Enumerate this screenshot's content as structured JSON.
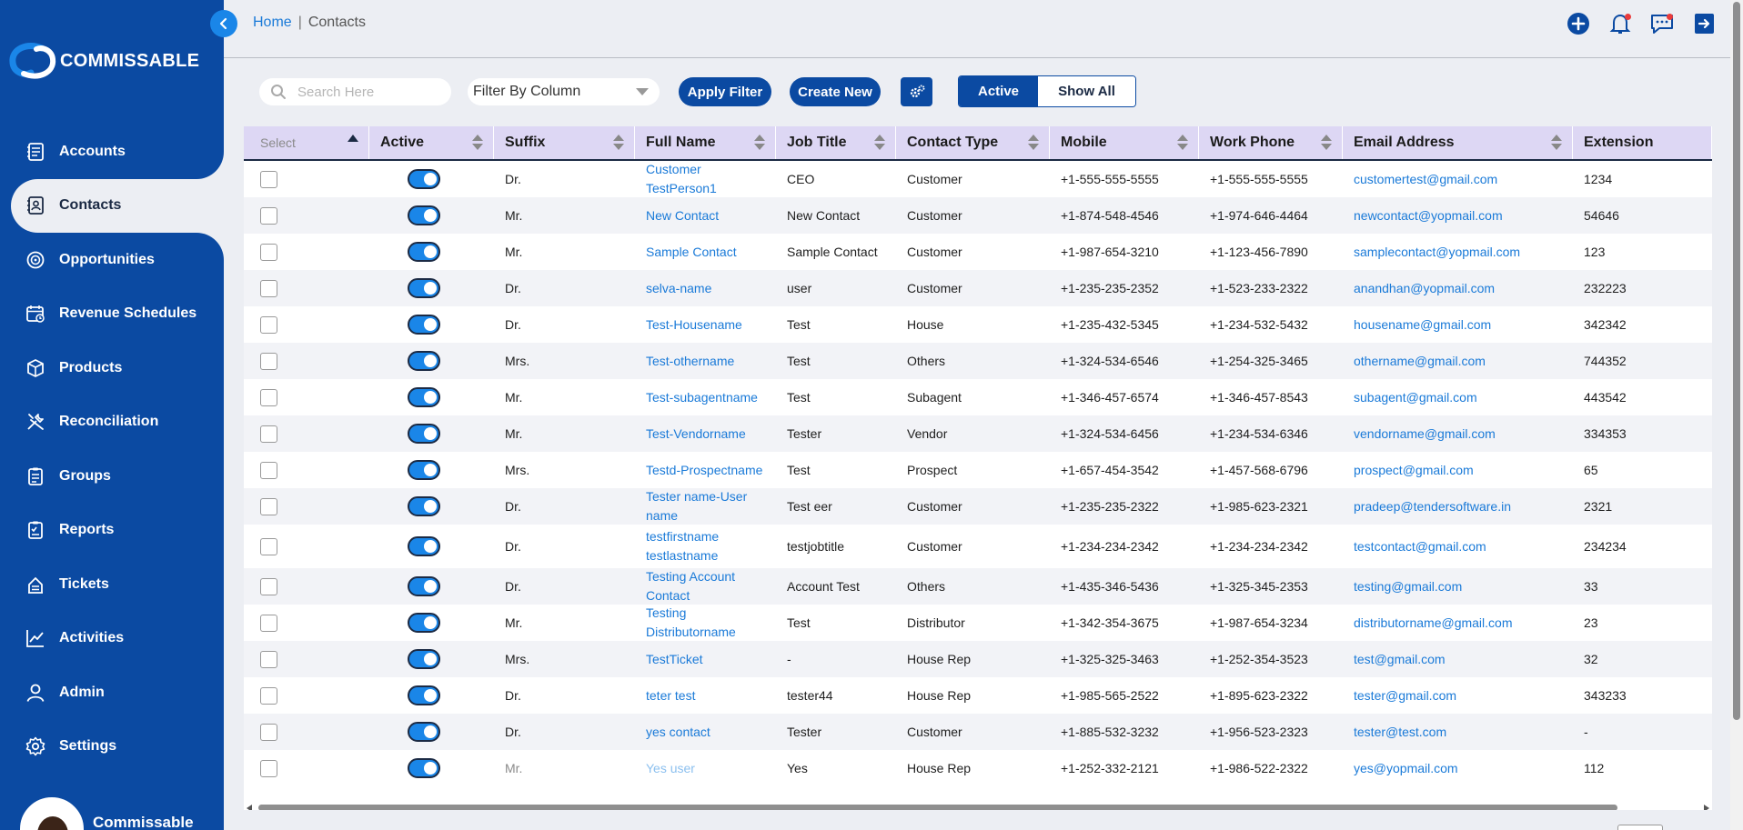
{
  "app": {
    "brand": "COMMISSABLE",
    "user_name": "Commissable"
  },
  "sidebar": {
    "items": [
      {
        "label": "Accounts",
        "icon": "accounts-icon",
        "active": false
      },
      {
        "label": "Contacts",
        "icon": "contacts-icon",
        "active": true
      },
      {
        "label": "Opportunities",
        "icon": "opportunities-icon",
        "active": false
      },
      {
        "label": "Revenue Schedules",
        "icon": "calendar-icon",
        "active": false
      },
      {
        "label": "Products",
        "icon": "box-icon",
        "active": false
      },
      {
        "label": "Reconciliation",
        "icon": "tools-icon",
        "active": false
      },
      {
        "label": "Groups",
        "icon": "clipboard-icon",
        "active": false
      },
      {
        "label": "Reports",
        "icon": "report-icon",
        "active": false
      },
      {
        "label": "Tickets",
        "icon": "ticket-icon",
        "active": false
      },
      {
        "label": "Activities",
        "icon": "chart-icon",
        "active": false
      },
      {
        "label": "Admin",
        "icon": "user-icon",
        "active": false
      },
      {
        "label": "Settings",
        "icon": "gear-icon",
        "active": false
      }
    ]
  },
  "breadcrumb": {
    "home": "Home",
    "separator": "|",
    "current": "Contacts"
  },
  "toolbar": {
    "search_placeholder": "Search Here",
    "filter_label": "Filter By Column",
    "apply_filter": "Apply Filter",
    "create_new": "Create New",
    "toggle_active": "Active",
    "toggle_show_all": "Show All"
  },
  "table": {
    "columns": [
      "Select",
      "Active",
      "Suffix",
      "Full Name",
      "Job Title",
      "Contact Type",
      "Mobile",
      "Work Phone",
      "Email Address",
      "Extension"
    ],
    "rows": [
      {
        "suffix": "Dr.",
        "full_name": "Customer TestPerson1",
        "job_title": "CEO",
        "contact_type": "Customer",
        "mobile": "+1-555-555-5555",
        "work_phone": "+1-555-555-5555",
        "email": "customertest@gmail.com",
        "extension": "1234"
      },
      {
        "suffix": "Mr.",
        "full_name": "New Contact",
        "job_title": "New Contact",
        "contact_type": "Customer",
        "mobile": "+1-874-548-4546",
        "work_phone": "+1-974-646-4464",
        "email": "newcontact@yopmail.com",
        "extension": "54646"
      },
      {
        "suffix": "Mr.",
        "full_name": "Sample Contact",
        "job_title": "Sample Contact",
        "contact_type": "Customer",
        "mobile": "+1-987-654-3210",
        "work_phone": "+1-123-456-7890",
        "email": "samplecontact@yopmail.com",
        "extension": "123"
      },
      {
        "suffix": "Dr.",
        "full_name": "selva-name",
        "job_title": "user",
        "contact_type": "Customer",
        "mobile": "+1-235-235-2352",
        "work_phone": "+1-523-233-2322",
        "email": "anandhan@yopmail.com",
        "extension": "232223"
      },
      {
        "suffix": "Dr.",
        "full_name": "Test-Housename",
        "job_title": "Test",
        "contact_type": "House",
        "mobile": "+1-235-432-5345",
        "work_phone": "+1-234-532-5432",
        "email": "housename@gmail.com",
        "extension": "342342"
      },
      {
        "suffix": "Mrs.",
        "full_name": "Test-othername",
        "job_title": "Test",
        "contact_type": "Others",
        "mobile": "+1-324-534-6546",
        "work_phone": "+1-254-325-3465",
        "email": "othername@gmail.com",
        "extension": "744352"
      },
      {
        "suffix": "Mr.",
        "full_name": "Test-subagentname",
        "job_title": "Test",
        "contact_type": "Subagent",
        "mobile": "+1-346-457-6574",
        "work_phone": "+1-346-457-8543",
        "email": "subagent@gmail.com",
        "extension": "443542"
      },
      {
        "suffix": "Mr.",
        "full_name": "Test-Vendorname",
        "job_title": "Tester",
        "contact_type": "Vendor",
        "mobile": "+1-324-534-6456",
        "work_phone": "+1-234-534-6346",
        "email": "vendorname@gmail.com",
        "extension": "334353"
      },
      {
        "suffix": "Mrs.",
        "full_name": "Testd-Prospectname",
        "job_title": "Test",
        "contact_type": "Prospect",
        "mobile": "+1-657-454-3542",
        "work_phone": "+1-457-568-6796",
        "email": "prospect@gmail.com",
        "extension": "65"
      },
      {
        "suffix": "Dr.",
        "full_name": "Tester name-User name",
        "job_title": "Test eer",
        "contact_type": "Customer",
        "mobile": "+1-235-235-2322",
        "work_phone": "+1-985-623-2321",
        "email": "pradeep@tendersoftware.in",
        "extension": "2321"
      },
      {
        "suffix": "Dr.",
        "full_name": "testfirstname testlastname",
        "job_title": "testjobtitle",
        "contact_type": "Customer",
        "mobile": "+1-234-234-2342",
        "work_phone": "+1-234-234-2342",
        "email": "testcontact@gmail.com",
        "extension": "234234"
      },
      {
        "suffix": "Dr.",
        "full_name": "Testing Account Contact",
        "job_title": "Account Test",
        "contact_type": "Others",
        "mobile": "+1-435-346-5436",
        "work_phone": "+1-325-345-2353",
        "email": "testing@gmail.com",
        "extension": "33"
      },
      {
        "suffix": "Mr.",
        "full_name": "Testing Distributorname",
        "job_title": "Test",
        "contact_type": "Distributor",
        "mobile": "+1-342-354-3675",
        "work_phone": "+1-987-654-3234",
        "email": "distributorname@gmail.com",
        "extension": "23"
      },
      {
        "suffix": "Mrs.",
        "full_name": "TestTicket",
        "job_title": "-",
        "contact_type": "House Rep",
        "mobile": "+1-325-325-3463",
        "work_phone": "+1-252-354-3523",
        "email": "test@gmail.com",
        "extension": "32"
      },
      {
        "suffix": "Dr.",
        "full_name": "teter test",
        "job_title": "tester44",
        "contact_type": "House Rep",
        "mobile": "+1-985-565-2522",
        "work_phone": "+1-895-623-2322",
        "email": "tester@gmail.com",
        "extension": "343233"
      },
      {
        "suffix": "Dr.",
        "full_name": "yes contact",
        "job_title": "Tester",
        "contact_type": "Customer",
        "mobile": "+1-885-532-3232",
        "work_phone": "+1-956-523-2323",
        "email": "tester@test.com",
        "extension": "-"
      },
      {
        "suffix": "Mr.",
        "full_name": "Yes user",
        "job_title": "Yes",
        "contact_type": "House Rep",
        "mobile": "+1-252-332-2121",
        "work_phone": "+1-986-522-2322",
        "email": "yes@yopmail.com",
        "extension": "112",
        "muted": true
      }
    ]
  },
  "colors": {
    "brand_blue": "#0b4aa2",
    "accent_blue": "#1a86e8",
    "link_blue": "#1a7ad8",
    "header_row": "#ddd7f4"
  }
}
